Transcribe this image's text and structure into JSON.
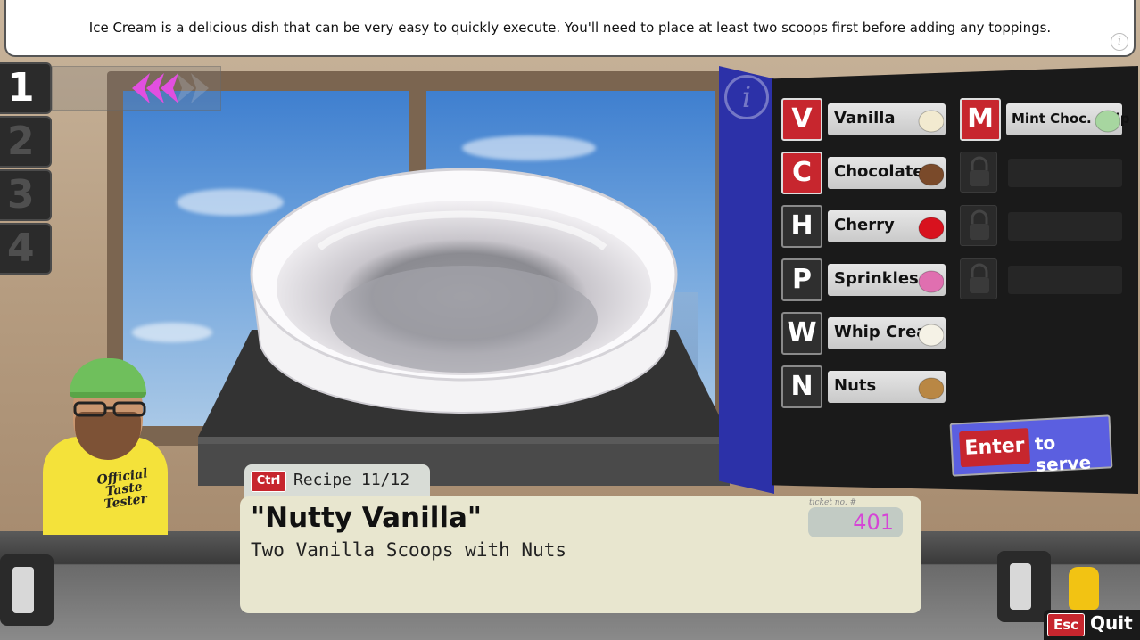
{
  "hint": {
    "text": "Ice Cream is a delicious dish that can be very easy to quickly execute. You'll need to place at least two scoops first before adding any toppings.",
    "info_icon": "info-icon"
  },
  "order_slots": [
    "1",
    "2",
    "3",
    "4"
  ],
  "active_slot": "1",
  "taster_shirt": [
    "Official",
    "Taste",
    "Tester"
  ],
  "ingredients": [
    {
      "key": "V",
      "label": "Vanilla",
      "color": "#f2ead0",
      "icon": "vanilla-scoop-icon"
    },
    {
      "key": "C",
      "label": "Chocolate",
      "color": "#7a4a2a",
      "icon": "chocolate-scoop-icon"
    },
    {
      "key": "H",
      "label": "Cherry",
      "color": "#d8121e",
      "icon": "cherry-icon"
    },
    {
      "key": "P",
      "label": "Sprinkles",
      "color": "#e06fb0",
      "icon": "sprinkles-icon"
    },
    {
      "key": "W",
      "label": "Whip Cream",
      "color": "#f5f2e6",
      "icon": "whip-cream-icon"
    },
    {
      "key": "N",
      "label": "Nuts",
      "color": "#b98744",
      "icon": "nuts-icon"
    }
  ],
  "ingredients_right": [
    {
      "key": "M",
      "label": "Mint Choc. Chip",
      "color": "#a7d6a0",
      "icon": "mint-scoop-icon"
    }
  ],
  "locked_slots": 3,
  "serve": {
    "key": "Enter",
    "label": "to serve"
  },
  "recipe": {
    "key": "Ctrl",
    "counter": "Recipe 11/12",
    "name": "\"Nutty Vanilla\"",
    "description": "Two Vanilla Scoops with Nuts",
    "ticket_label": "ticket no. #",
    "ticket_number": "401"
  },
  "quit": {
    "key": "Esc",
    "label": "Quit"
  },
  "colors": {
    "key_red": "#c7262e",
    "info_blue": "#2c31a8",
    "serve_blue": "#5b5fe0",
    "ticket_number": "#d545d6",
    "arrow_pink": "#e24fe0"
  }
}
